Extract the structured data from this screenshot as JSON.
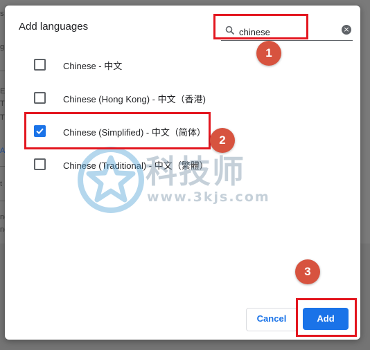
{
  "background_fragments": [
    "s",
    "g",
    "Ei",
    "T",
    "Tl",
    "A",
    "t",
    "ne",
    "ne"
  ],
  "dialog": {
    "title": "Add languages",
    "search": {
      "value": "chinese",
      "icon": "search-icon",
      "clear_icon": "close-icon"
    },
    "languages": [
      {
        "label": "Chinese - 中文",
        "checked": false
      },
      {
        "label": "Chinese (Hong Kong) - 中文（香港)",
        "checked": false
      },
      {
        "label": "Chinese (Simplified) - 中文（简体）",
        "checked": true
      },
      {
        "label": "Chinese (Traditional) - 中文（繁體）",
        "checked": false
      }
    ],
    "buttons": {
      "cancel": "Cancel",
      "add": "Add"
    }
  },
  "annotations": {
    "step1": "1",
    "step2": "2",
    "step3": "3",
    "highlight_color": "#e3161f",
    "badge_color": "#d7533f"
  },
  "watermark": {
    "brand": "科技师",
    "url": "www.3kjs.com"
  },
  "colors": {
    "accent": "#1a73e8",
    "text": "#202124"
  }
}
